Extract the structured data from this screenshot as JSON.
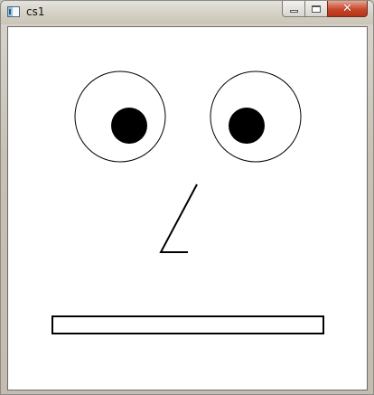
{
  "window": {
    "title": "cs1",
    "icon": "application-window-icon",
    "controls": {
      "minimize_icon": "minimize-icon",
      "maximize_icon": "maximize-icon",
      "close_icon": "close-icon",
      "close_glyph": "✕"
    }
  },
  "drawing": {
    "subject": "face",
    "background_color": "#ffffff",
    "stroke_color": "#000000",
    "pupil_fill": "#000000",
    "parts": [
      "left-eye",
      "right-eye",
      "nose",
      "mouth"
    ]
  }
}
